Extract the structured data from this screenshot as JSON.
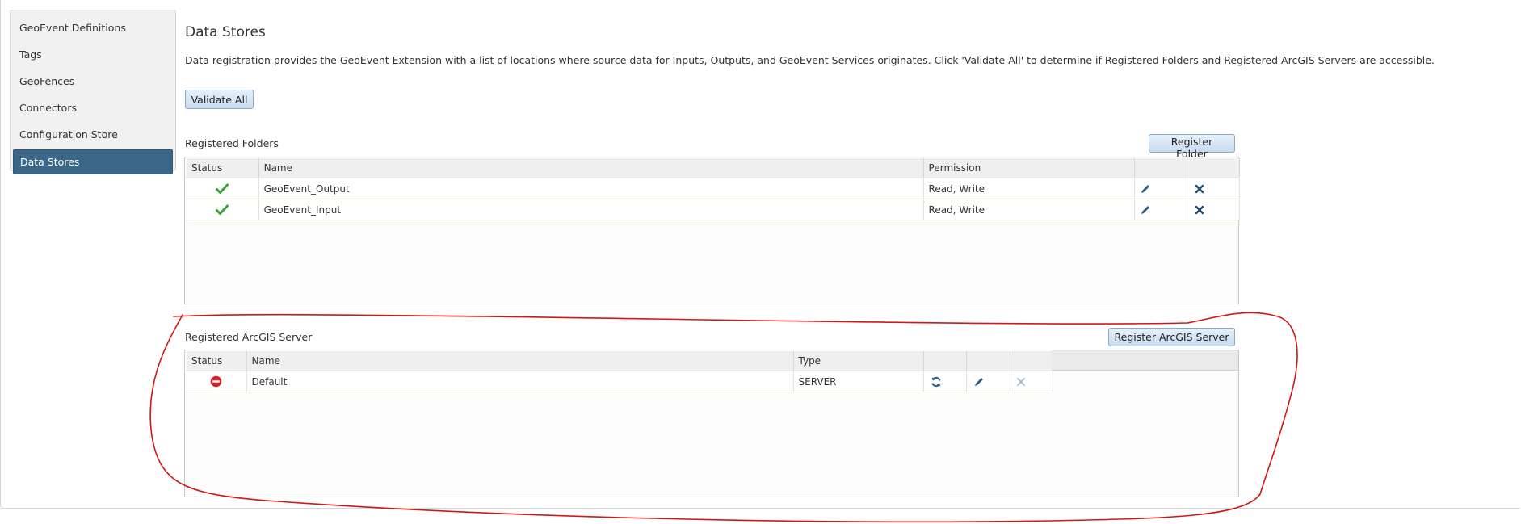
{
  "sidebar": {
    "items": [
      {
        "label": "GeoEvent Definitions"
      },
      {
        "label": "Tags"
      },
      {
        "label": "GeoFences"
      },
      {
        "label": "Connectors"
      },
      {
        "label": "Configuration Store"
      },
      {
        "label": "Data Stores",
        "active": true
      }
    ]
  },
  "main": {
    "title": "Data Stores",
    "description": "Data registration provides the GeoEvent Extension with a list of locations where source data for Inputs, Outputs, and GeoEvent Services originates. Click 'Validate All' to determine if Registered Folders and Registered ArcGIS Servers are accessible.",
    "validate_all_label": "Validate All"
  },
  "folders": {
    "title": "Registered Folders",
    "register_label": "Register Folder",
    "columns": {
      "status": "Status",
      "name": "Name",
      "permission": "Permission"
    },
    "rows": [
      {
        "status": "valid",
        "status_icon": "check-icon",
        "name": "GeoEvent_Output",
        "permission": "Read, Write"
      },
      {
        "status": "valid",
        "status_icon": "check-icon",
        "name": "GeoEvent_Input",
        "permission": "Read, Write"
      }
    ]
  },
  "servers": {
    "title": "Registered ArcGIS Server",
    "register_label": "Register ArcGIS Server",
    "columns": {
      "status": "Status",
      "name": "Name",
      "type": "Type"
    },
    "rows": [
      {
        "status": "error",
        "status_icon": "no-entry-icon",
        "name": "Default",
        "type": "SERVER"
      }
    ]
  },
  "colors": {
    "active_nav": "#3a6788",
    "check_green": "#3aa33a",
    "error_red": "#d0202a",
    "icon_blue": "#2a5b86",
    "annotation_red": "#d01818"
  }
}
